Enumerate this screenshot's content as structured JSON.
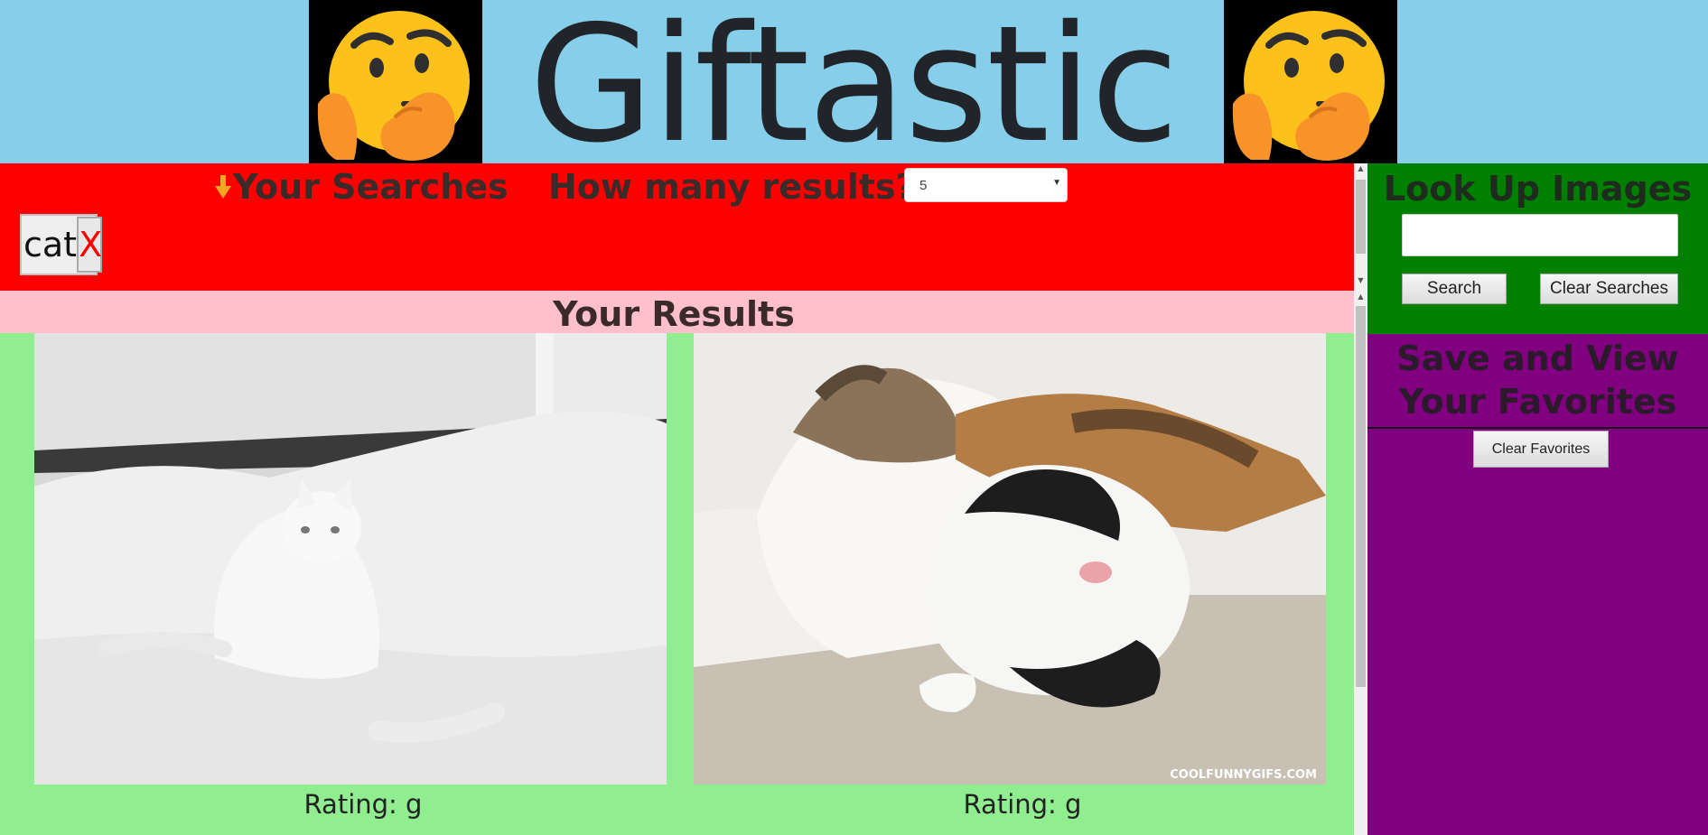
{
  "header": {
    "title": "Giftastic",
    "left_icon": "thinking-face-emoji",
    "right_icon": "thinking-face-emoji"
  },
  "searches": {
    "title": "Your Searches",
    "title_icon": "down-arrow-icon",
    "count_label": "How many results?",
    "count_value": "5",
    "chips": [
      {
        "label": "cat",
        "remove_label": "X"
      }
    ]
  },
  "results": {
    "title": "Your Results",
    "items": [
      {
        "image": "white-cat-on-bed-gif",
        "rating": "Rating: g"
      },
      {
        "image": "calico-cat-grooming-cat-gif",
        "watermark": "COOLFUNNYGIFS.COM",
        "rating": "Rating: g"
      }
    ]
  },
  "lookup": {
    "title": "Look Up Images",
    "input_value": "",
    "search_label": "Search",
    "clear_searches_label": "Clear Searches"
  },
  "favorites": {
    "title": "Save and View Your Favorites",
    "clear_label": "Clear Favorites"
  },
  "colors": {
    "header_bg": "#87ceeb",
    "searches_bg": "#ff0000",
    "results_header_bg": "#ffc0cb",
    "results_bg": "#90ee90",
    "lookup_bg": "#008000",
    "favorites_bg": "#800080"
  }
}
